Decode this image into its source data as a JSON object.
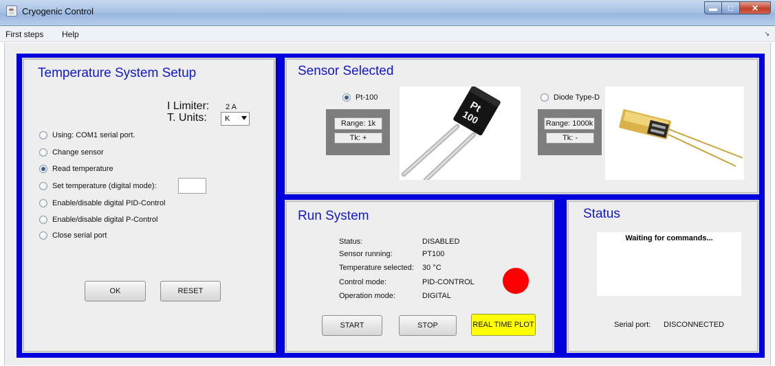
{
  "window": {
    "title": "Cryogenic Control"
  },
  "menu": {
    "first_steps": "First steps",
    "help": "Help"
  },
  "setup": {
    "title": "Temperature System Setup",
    "i_limiter_label": "I Limiter:",
    "i_limiter_value": "2 A",
    "t_units_label": "T. Units:",
    "t_units_value": "K",
    "options": [
      "Using: COM1 serial port.",
      "Change sensor",
      "Read temperature",
      "Set temperature (digital mode):",
      "Enable/disable digital PID-Control",
      "Enable/disable digital P-Control",
      "Close serial port"
    ],
    "selected_option": "Read temperature",
    "ok_label": "OK",
    "reset_label": "RESET"
  },
  "sensor": {
    "title": "Sensor Selected",
    "pt100": {
      "label": "Pt-100",
      "range": "Range: 1k",
      "tk": "Tk: +",
      "selected": true
    },
    "diode": {
      "label": "Diode Type-D",
      "range": "Range: 1000k",
      "tk": "Tk: -",
      "selected": false
    }
  },
  "run": {
    "title": "Run System",
    "rows": [
      {
        "label": "Status:",
        "value": "DISABLED"
      },
      {
        "label": "Sensor running:",
        "value": "PT100"
      },
      {
        "label": "Temperature selected:",
        "value": "30 °C"
      },
      {
        "label": "Control mode:",
        "value": "PID-CONTROL"
      },
      {
        "label": "Operation mode:",
        "value": "DIGITAL"
      }
    ],
    "indicator_color": "#ff0000",
    "start_label": "START",
    "stop_label": "STOP",
    "plot_label": "REAL TIME PLOT"
  },
  "status": {
    "title": "Status",
    "message": "Waiting for commands...",
    "serial_label": "Serial port:",
    "serial_value": "DISCONNECTED"
  },
  "colors": {
    "accent_blue": "#0000dc",
    "title_blue": "#1018c8",
    "plot_button": "#ffff00"
  }
}
